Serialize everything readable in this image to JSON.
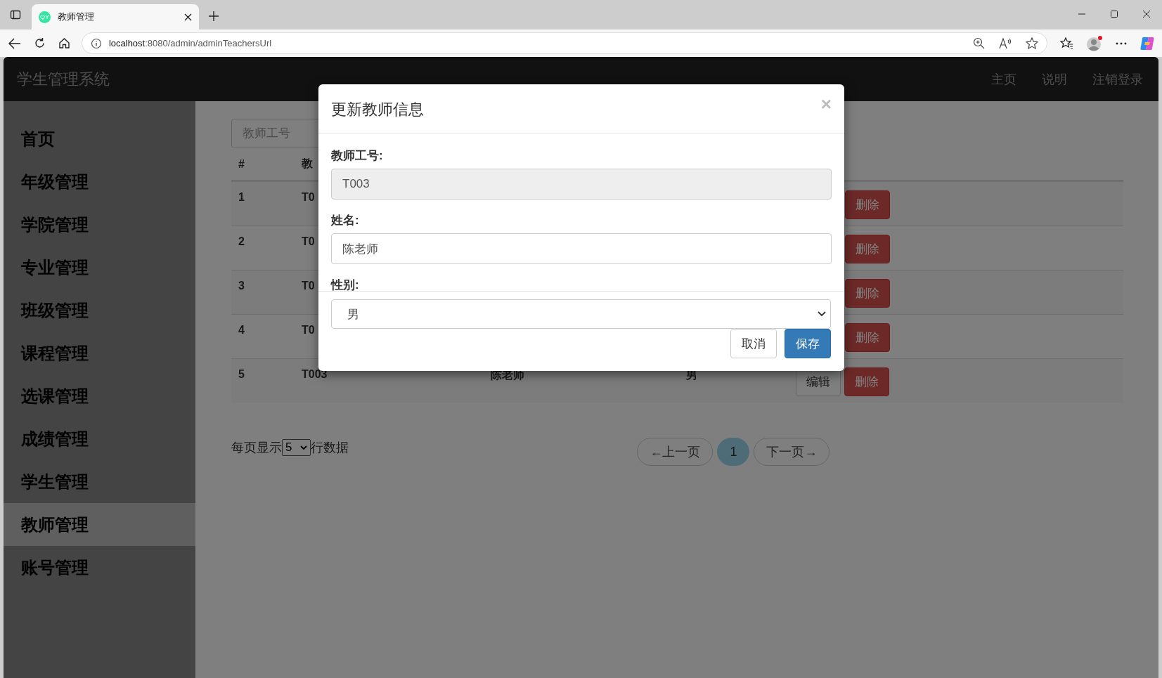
{
  "browser": {
    "tab_title": "教师管理",
    "favicon": "QY",
    "url_host": "localhost",
    "url_path": ":8080/admin/adminTeachersUrl"
  },
  "navbar": {
    "brand": "学生管理系统",
    "links": [
      "主页",
      "说明",
      "注销登录"
    ]
  },
  "sidebar": {
    "items": [
      {
        "label": "首页",
        "selected": false
      },
      {
        "label": "年级管理",
        "selected": false
      },
      {
        "label": "学院管理",
        "selected": false
      },
      {
        "label": "专业管理",
        "selected": false
      },
      {
        "label": "班级管理",
        "selected": false
      },
      {
        "label": "课程管理",
        "selected": false
      },
      {
        "label": "选课管理",
        "selected": false
      },
      {
        "label": "成绩管理",
        "selected": false
      },
      {
        "label": "学生管理",
        "selected": false
      },
      {
        "label": "教师管理",
        "selected": true
      },
      {
        "label": "账号管理",
        "selected": false
      }
    ]
  },
  "search": {
    "placeholder": "教师工号"
  },
  "table": {
    "columns": [
      "#",
      "教"
    ],
    "rows": [
      {
        "cells": [
          "1",
          "T0"
        ],
        "delete": "删除"
      },
      {
        "cells": [
          "2",
          "T0"
        ],
        "delete": "删除"
      },
      {
        "cells": [
          "3",
          "T0"
        ],
        "delete": "删除"
      },
      {
        "cells": [
          "4",
          "T0"
        ],
        "delete": "删除"
      },
      {
        "cells": [
          "5",
          "T003",
          "陈老师",
          "男"
        ],
        "edit": "编辑",
        "delete": "删除"
      }
    ]
  },
  "pagination": {
    "prefix": "每页显示",
    "page_size": "5",
    "suffix": "行数据",
    "prev": "←上一页",
    "pages": [
      {
        "label": "1",
        "selected": true
      }
    ],
    "next": "下一页→"
  },
  "modal": {
    "title": "更新教师信息",
    "close": "×",
    "fields": [
      {
        "label": "教师工号:",
        "kind": "text",
        "value": "T003",
        "disabled": true
      },
      {
        "label": "姓名:",
        "kind": "text",
        "value": "陈老师",
        "disabled": false
      },
      {
        "label": "性别:",
        "kind": "select",
        "value": "男",
        "disabled": false
      }
    ],
    "buttons": [
      {
        "label": "取消",
        "kind": "default"
      },
      {
        "label": "保存",
        "kind": "primary"
      }
    ]
  }
}
